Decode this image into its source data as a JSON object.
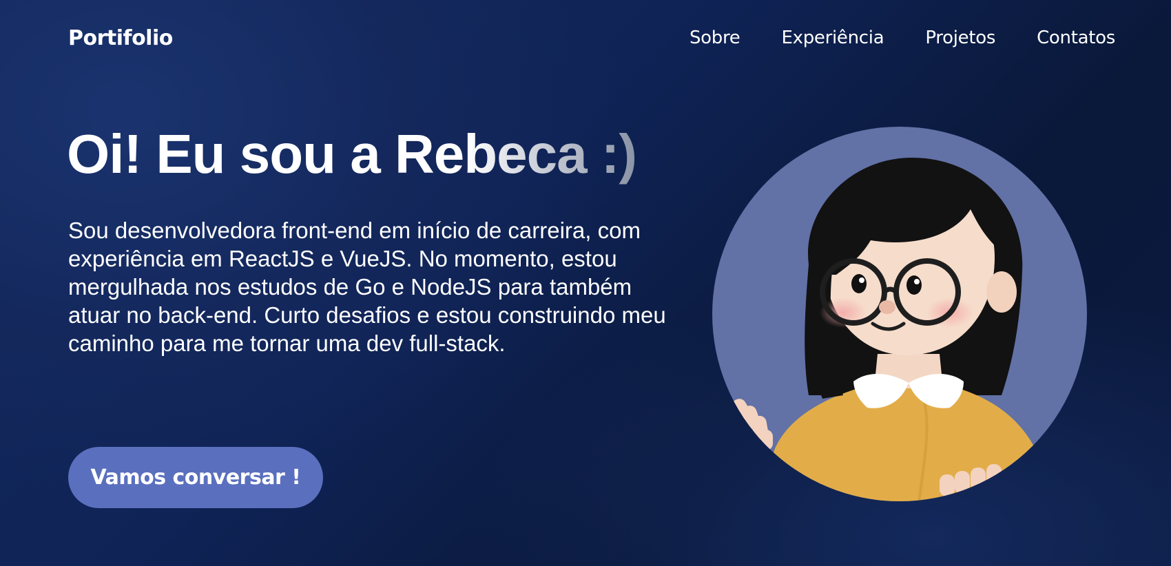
{
  "nav": {
    "logo": "Portifolio",
    "items": [
      {
        "label": "Sobre"
      },
      {
        "label": "Experiência"
      },
      {
        "label": "Projetos"
      },
      {
        "label": "Contatos"
      }
    ]
  },
  "hero": {
    "title": "Oi! Eu sou a Rebeca :)",
    "description": "Sou desenvolvedora front-end em início de carreira, com experiência em ReactJS e VueJS. No momento, estou mergulhada nos estudos de Go e NodeJS para também atuar no back-end. Curto desafios e estou construindo meu caminho para me tornar uma dev full-stack.",
    "cta_label": "Vamos conversar !"
  },
  "colors": {
    "background": "#0f2356",
    "accent": "#5a6fbe",
    "avatar_circle": "#6271a6",
    "shirt": "#e2ad48"
  }
}
